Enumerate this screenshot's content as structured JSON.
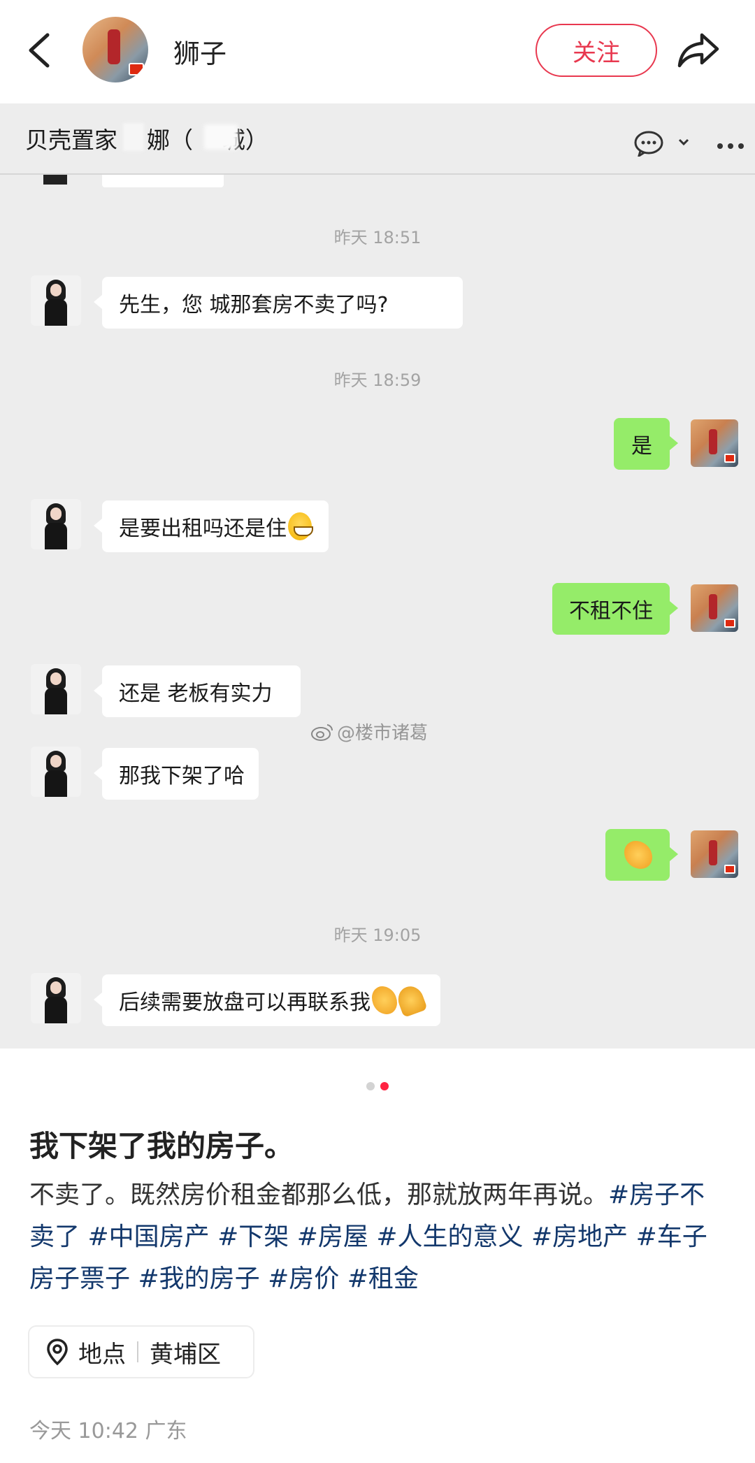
{
  "header": {
    "author_name": "狮子",
    "follow_label": "关注"
  },
  "chat": {
    "title": "贝壳置家    娜（    城）",
    "messages": [
      {
        "type": "timestamp",
        "text": "昨天 18:51"
      },
      {
        "type": "left",
        "text": "先生，您    城那套房不卖了吗?"
      },
      {
        "type": "timestamp",
        "text": "昨天 18:59"
      },
      {
        "type": "right",
        "text": "是"
      },
      {
        "type": "left",
        "text": "是要出租吗还是住"
      },
      {
        "type": "right",
        "text": "不租不住"
      },
      {
        "type": "left",
        "text": "还是  老板有实力"
      },
      {
        "type": "left",
        "text": "那我下架了哈"
      },
      {
        "type": "right",
        "text": ""
      },
      {
        "type": "timestamp",
        "text": "昨天 19:05"
      },
      {
        "type": "left",
        "text": "后续需要放盘可以再联系我"
      }
    ],
    "watermark": "@楼市诸葛"
  },
  "post": {
    "title": "我下架了我的房子。",
    "body": "不卖了。既然房价租金都那么低，那就放两年再说。",
    "tags": [
      "#房子不卖了",
      "#中国房产",
      "#下架",
      "#房屋",
      "#人生的意义",
      "#房地产",
      "#车子房子票子",
      "#我的房子",
      "#房价",
      "#租金"
    ],
    "location_label": "地点",
    "location_value": "黄埔区",
    "meta": "今天 10:42 广东"
  },
  "carousel": {
    "count": 2,
    "active": 2
  },
  "colors": {
    "accent": "#ff2442",
    "follow": "#e8384f",
    "my_bubble": "#95ec69",
    "tag": "#13386c"
  }
}
